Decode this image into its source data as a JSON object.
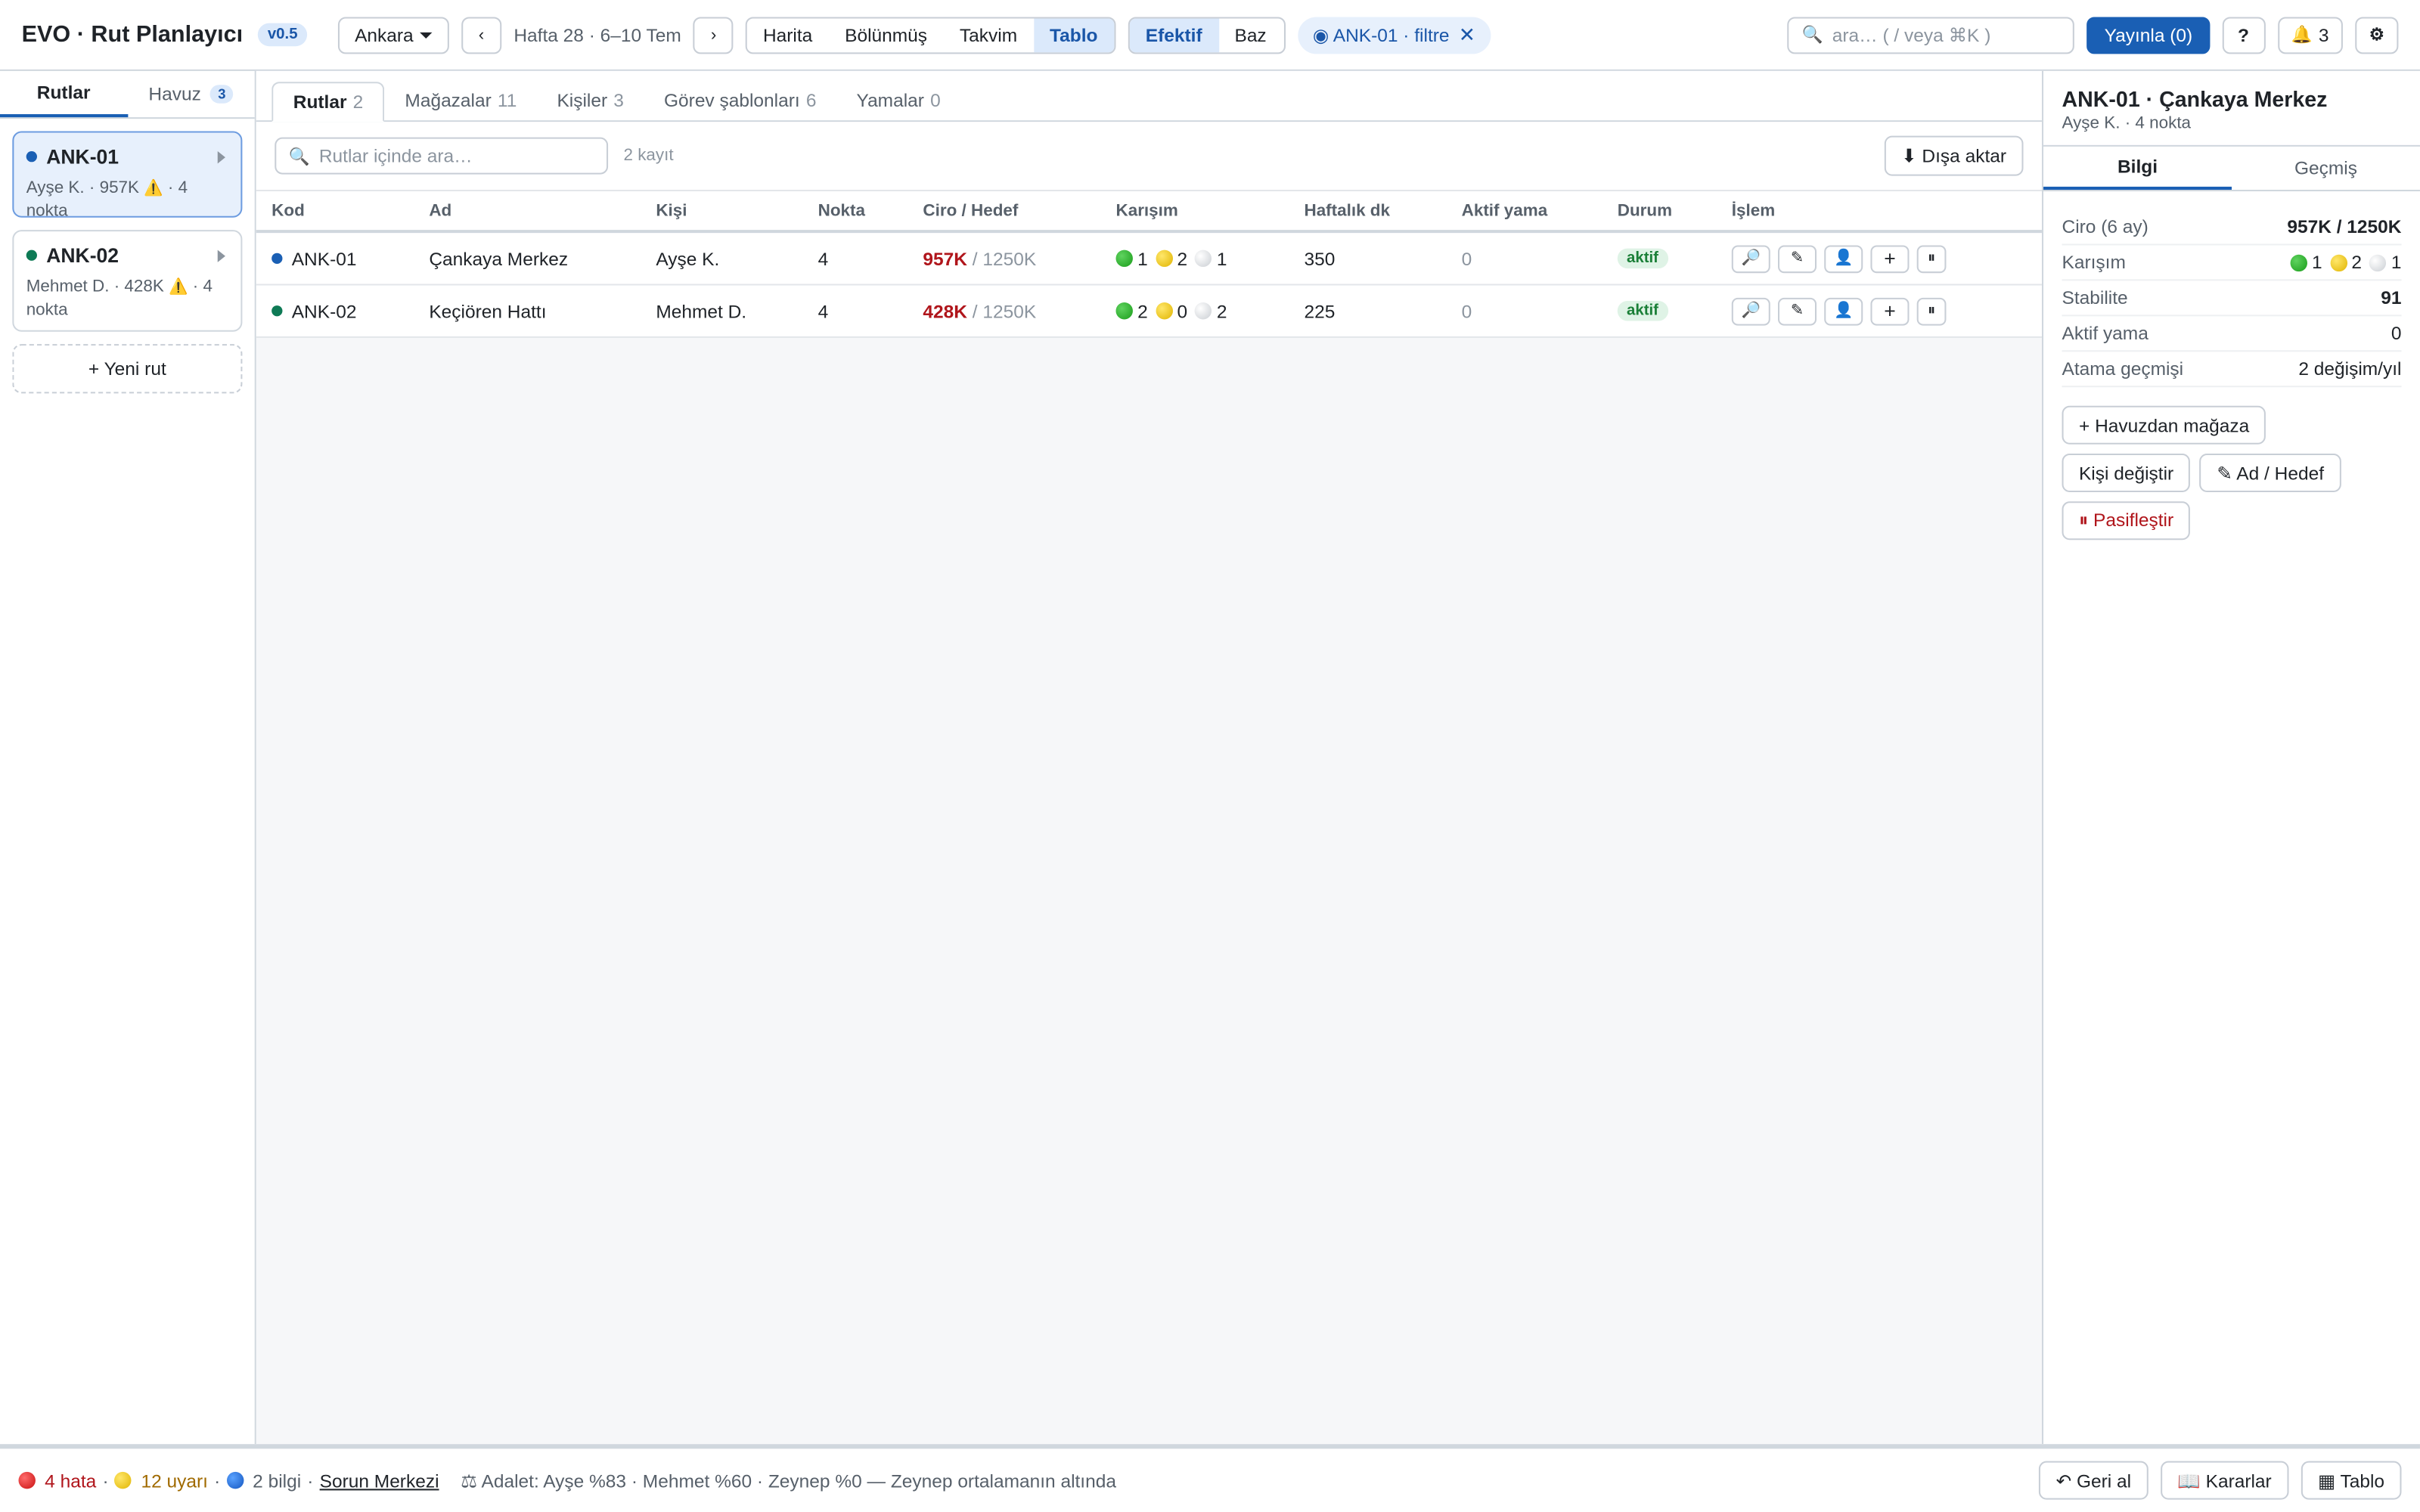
{
  "header": {
    "title": "EVO · Rut Planlayıcı",
    "version": "v0.5",
    "city": "Ankara",
    "prev": "‹",
    "next": "›",
    "week": "Hafta 28 · 6–10 Tem",
    "views": [
      "Harita",
      "Bölünmüş",
      "Takvim",
      "Tablo"
    ],
    "active_view": "Tablo",
    "modes": [
      "Efektif",
      "Baz"
    ],
    "active_mode": "Efektif",
    "filter_chip": "◉ ANK-01 · filtre",
    "filter_close": "✕",
    "search_placeholder": "ara…  ( / veya ⌘K )",
    "publish": "Yayınla (0)",
    "help": "?",
    "notifications": "3",
    "bell": "🔔",
    "settings": "⚙",
    "search_icon": "🔍"
  },
  "left": {
    "tabs": [
      {
        "label": "Rutlar",
        "count": ""
      },
      {
        "label": "Havuz",
        "count": "3"
      }
    ],
    "routes": [
      {
        "code": "ANK-01",
        "color": "#1a5fb4",
        "sub_before": "Ayşe K. · 957K",
        "warn": "⚠️",
        "sub_after": "· 4 nokta"
      },
      {
        "code": "ANK-02",
        "color": "#0e7a55",
        "sub_before": "Mehmet D. · 428K",
        "warn": "⚠️",
        "sub_after": "· 4 nokta"
      }
    ],
    "new_route": "+ Yeni rut"
  },
  "main": {
    "tabs": [
      {
        "label": "Rutlar",
        "count": "2"
      },
      {
        "label": "Mağazalar",
        "count": "11"
      },
      {
        "label": "Kişiler",
        "count": "3"
      },
      {
        "label": "Görev şablonları",
        "count": "6"
      },
      {
        "label": "Yamalar",
        "count": "0"
      }
    ],
    "search_placeholder": "Rutlar içinde ara…",
    "record_count": "2 kayıt",
    "export": "⬇ Dışa aktar",
    "columns": [
      "Kod",
      "Ad",
      "Kişi",
      "Nokta",
      "Ciro / Hedef",
      "Karışım",
      "Haftalık dk",
      "Aktif yama",
      "Durum",
      "İşlem"
    ],
    "rows": [
      {
        "code": "ANK-01",
        "color": "#1a5fb4",
        "name": "Çankaya Merkez",
        "person": "Ayşe K.",
        "points": "4",
        "revenue": "957K",
        "target": "/ 1250K",
        "mix": [
          "1",
          "2",
          "1"
        ],
        "weekly": "350",
        "patch": "0",
        "status": "aktif"
      },
      {
        "code": "ANK-02",
        "color": "#0e7a55",
        "name": "Keçiören Hattı",
        "person": "Mehmet D.",
        "points": "4",
        "revenue": "428K",
        "target": "/ 1250K",
        "mix": [
          "2",
          "0",
          "2"
        ],
        "weekly": "225",
        "patch": "0",
        "status": "aktif"
      }
    ],
    "row_actions": [
      "🔎",
      "✎",
      "👤",
      "+",
      "⏸"
    ]
  },
  "right": {
    "title": "ANK-01 · Çankaya Merkez",
    "subtitle": "Ayşe K. · 4 nokta",
    "tabs": [
      "Bilgi",
      "Geçmiş"
    ],
    "fields": {
      "revenue_label": "Ciro (6 ay)",
      "revenue_value": "957K / 1250K",
      "mix_label": "Karışım",
      "mix": [
        "1",
        "2",
        "1"
      ],
      "stability_label": "Stabilite",
      "stability_value": "91",
      "patch_label": "Aktif yama",
      "patch_value": "0",
      "history_label": "Atama geçmişi",
      "history_value": "2 değişim/yıl"
    },
    "actions": {
      "add_from_pool": "+ Havuzdan mağaza",
      "change_person": "Kişi değiştir",
      "edit": "✎ Ad / Hedef",
      "deactivate": "⏸ Pasifleştir"
    }
  },
  "status": {
    "errors": "4 hata",
    "warnings": "12 uyarı",
    "infos": "2 bilgi",
    "center": "Sorun Merkezi",
    "fairness": "⚖ Adalet: Ayşe %83 · Mehmet %60 · Zeynep %0 — Zeynep ortalamanın altında",
    "undo": "↶ Geri al",
    "decisions": "📖 Kararlar",
    "table": "▦ Tablo"
  }
}
